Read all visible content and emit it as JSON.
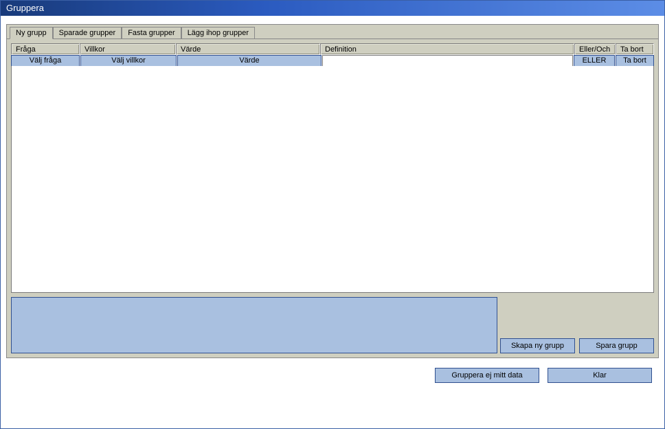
{
  "window": {
    "title": "Gruppera"
  },
  "tabs": [
    {
      "label": "Ny grupp",
      "active": true
    },
    {
      "label": "Sparade grupper",
      "active": false
    },
    {
      "label": "Fasta grupper",
      "active": false
    },
    {
      "label": "Lägg ihop grupper",
      "active": false
    }
  ],
  "grid": {
    "headers": {
      "fraga": "Fråga",
      "villkor": "Villkor",
      "varde": "Värde",
      "definition": "Definition",
      "eller_och": "Eller/Och",
      "ta_bort": "Ta bort"
    },
    "row": {
      "valj_fraga": "Välj fråga",
      "valj_villkor": "Välj villkor",
      "varde": "Värde",
      "definition": "",
      "eller": "ELLER",
      "ta_bort": "Ta bort"
    }
  },
  "buttons": {
    "skapa_ny_grupp": "Skapa ny grupp",
    "spara_grupp": "Spara grupp",
    "gruppera_ej": "Gruppera ej mitt data",
    "klar": "Klar"
  }
}
